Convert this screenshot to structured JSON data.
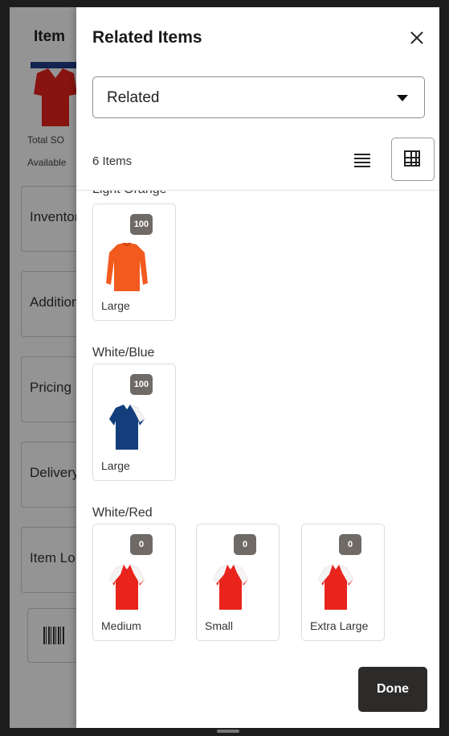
{
  "background": {
    "title": "Item",
    "total_label": "Total SO",
    "available_label": "Available",
    "sections": [
      "Inventory",
      "Additional",
      "Pricing",
      "Delivery",
      "Item Lo"
    ]
  },
  "drawer": {
    "title": "Related Items",
    "select": {
      "value": "Related"
    },
    "count": "6 Items",
    "cut_off_label": "Light Orange",
    "groups": [
      {
        "name": "White/Blue",
        "items": [
          {
            "qty": "100",
            "size": "Large"
          }
        ]
      },
      {
        "name": "White/Red",
        "items": [
          {
            "qty": "0",
            "size": "Medium"
          },
          {
            "qty": "0",
            "size": "Small"
          },
          {
            "qty": "0",
            "size": "Extra Large"
          }
        ]
      }
    ],
    "top_item": {
      "qty": "100",
      "size": "Large"
    },
    "done_label": "Done"
  },
  "icons": [
    "close-icon",
    "chevron-down-icon",
    "list-view-icon",
    "grid-view-icon",
    "barcode-icon"
  ],
  "colors": {
    "badge": "#6f6a66",
    "done_button": "#2d2b2a",
    "shirt_orange": "#f25a1e",
    "shirt_blue": "#123e7c",
    "shirt_red": "#e8241d"
  }
}
